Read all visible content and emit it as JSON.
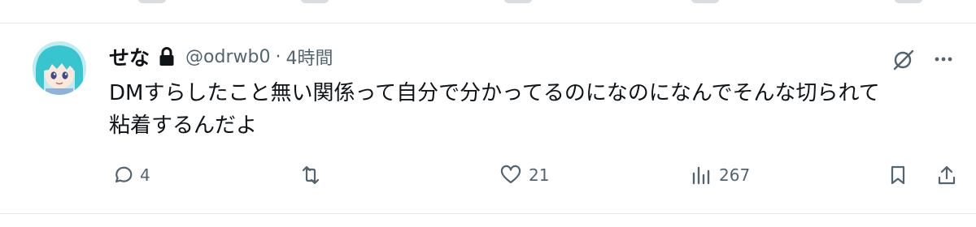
{
  "post": {
    "author": {
      "display_name": "せな",
      "handle": "@odrwb0",
      "separator": "·",
      "timestamp": "4時間",
      "protected": true
    },
    "text_line1": "DMすらしたこと無い関係って自分で分かってるのになのになんでそんな切られて",
    "text_line2": "粘着するんだよ",
    "metrics": {
      "replies": "4",
      "reposts": "",
      "likes": "21",
      "views": "267"
    }
  },
  "icons": {
    "header": [
      "grok-icon",
      "more-icon"
    ],
    "actions": [
      "reply-icon",
      "repost-icon",
      "like-icon",
      "views-icon",
      "bookmark-icon",
      "share-icon"
    ]
  },
  "colors": {
    "text_primary": "#0f1419",
    "text_secondary": "#536471",
    "divider": "#e6e9eb"
  }
}
